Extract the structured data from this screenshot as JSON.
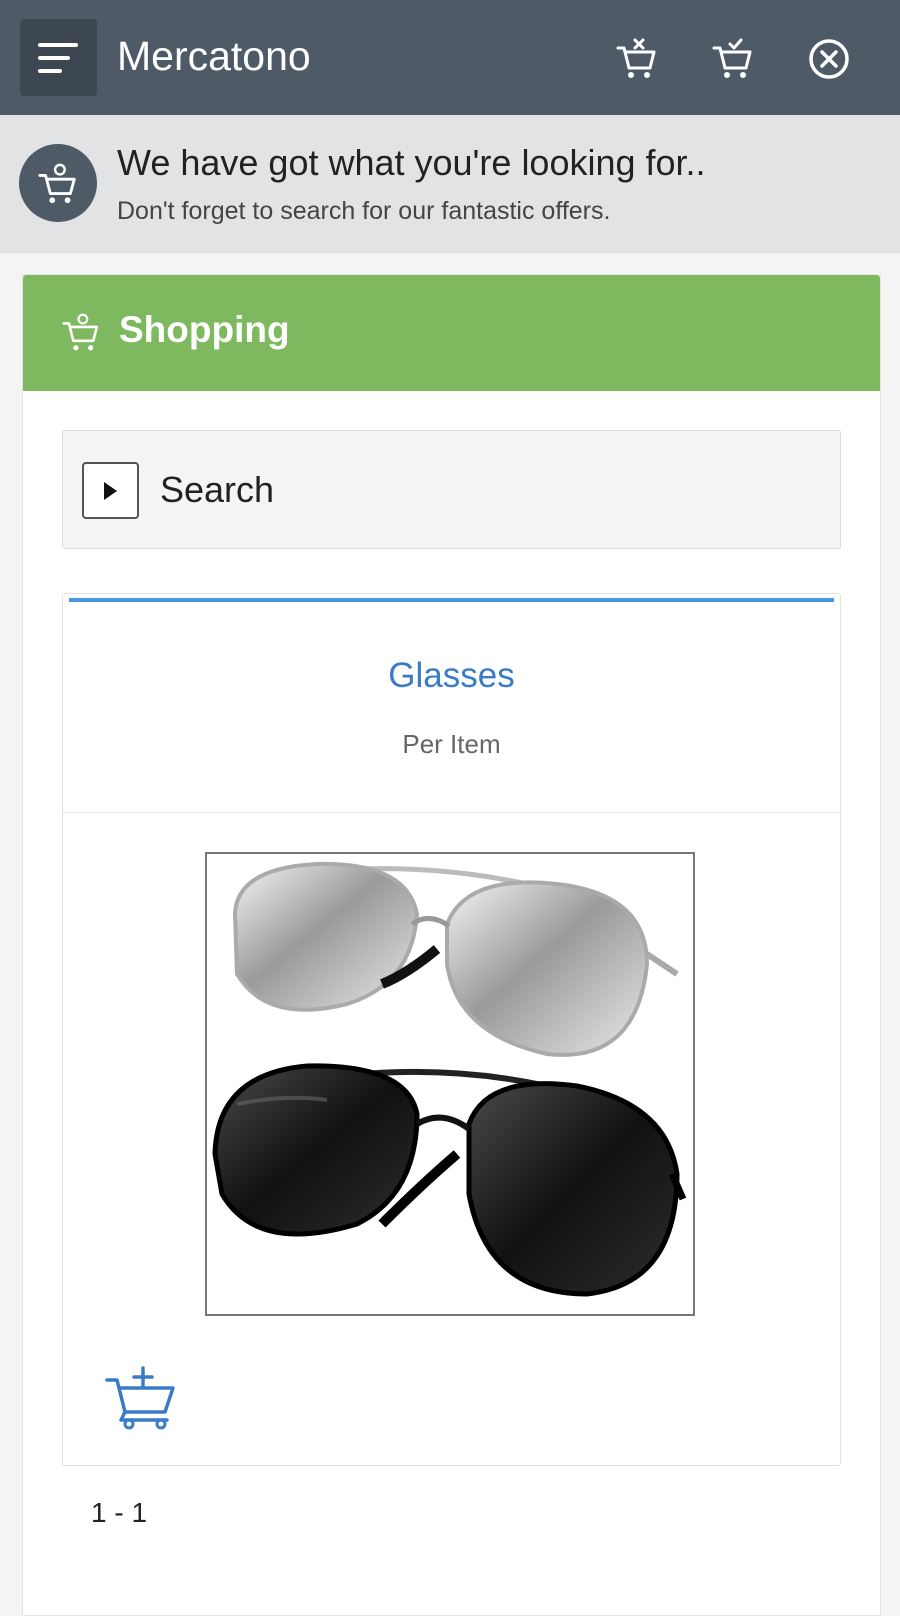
{
  "app": {
    "title": "Mercatono"
  },
  "topbar": {
    "icons": [
      "menu-icon",
      "cart-remove-icon",
      "cart-check-icon",
      "close-circle-icon"
    ]
  },
  "banner": {
    "title": "We have got what you're looking for..",
    "subtitle": "Don't forget to search for our fantastic offers."
  },
  "section": {
    "title": "Shopping"
  },
  "search": {
    "label": "Search"
  },
  "product": {
    "name": "Glasses",
    "unit": "Per Item"
  },
  "pagination": {
    "range": "1 - 1"
  },
  "colors": {
    "topbar": "#4e5a66",
    "header_green": "#7fb95f",
    "accent_blue": "#4a97e0",
    "link_blue": "#3a7bc8"
  }
}
